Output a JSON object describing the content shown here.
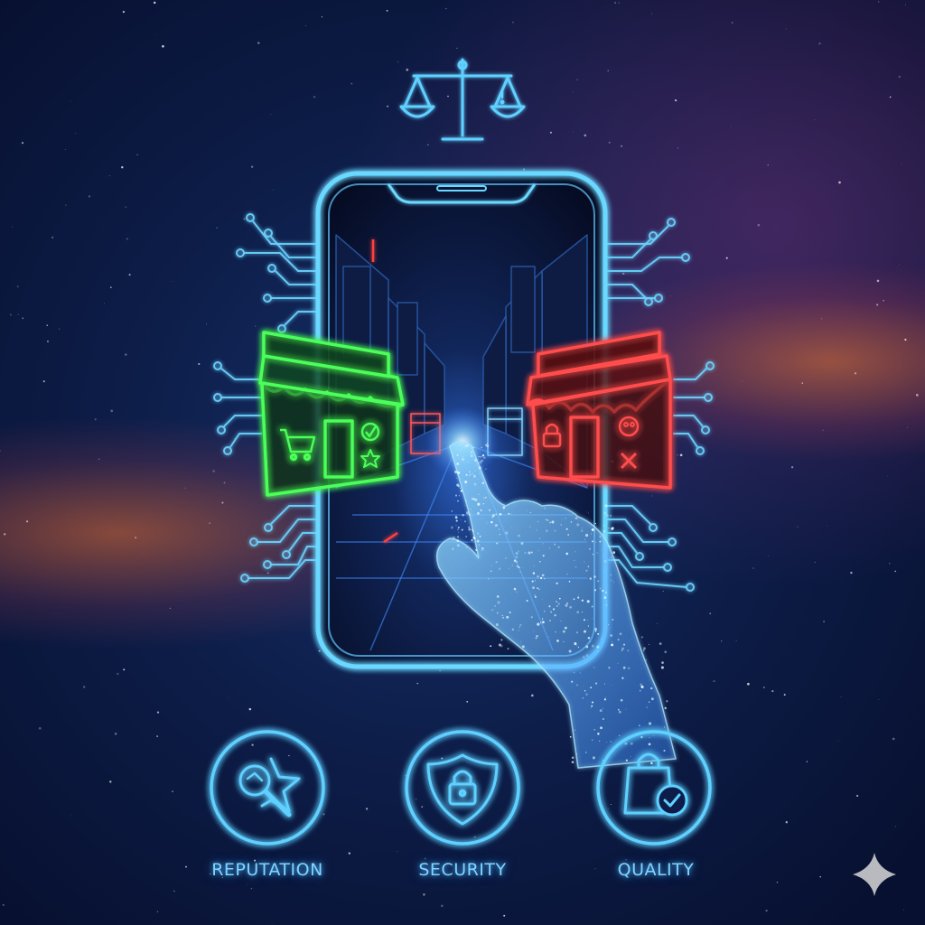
{
  "pillars": [
    {
      "label": "REPUTATION",
      "icon": "star-magnifier-icon"
    },
    {
      "label": "SECURITY",
      "icon": "shield-lock-icon"
    },
    {
      "label": "QUALITY",
      "icon": "shopping-bag-check-icon"
    }
  ],
  "stores": {
    "trusted": {
      "color": "#4cff5a",
      "icons": [
        "cart-icon",
        "check-icon",
        "star-icon"
      ]
    },
    "untrusted": {
      "color": "#ff4d4d",
      "icons": [
        "lock-icon",
        "skull-icon",
        "x-icon"
      ]
    }
  },
  "colors": {
    "neon_blue": "#5fd0ff",
    "neon_green": "#4cff5a",
    "neon_red": "#ff4d4d",
    "nebula_orange": "#eb6e32"
  },
  "top_icon": "balance-scale-icon"
}
